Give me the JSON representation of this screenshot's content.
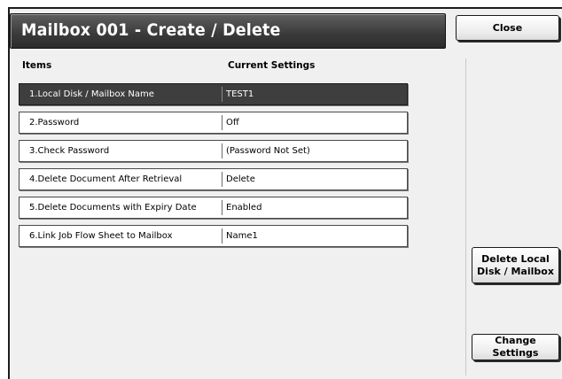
{
  "window": {
    "title": "Mailbox 001 - Create / Delete"
  },
  "buttons": {
    "close": "Close",
    "delete_local_disk": "Delete Local Disk / Mailbox",
    "change_settings": "Change Settings"
  },
  "table": {
    "headers": {
      "items": "Items",
      "current_settings": "Current Settings"
    },
    "rows": [
      {
        "item": "1.Local Disk / Mailbox Name",
        "value": "TEST1",
        "selected": true
      },
      {
        "item": "2.Password",
        "value": "Off",
        "selected": false
      },
      {
        "item": "3.Check Password",
        "value": "(Password Not Set)",
        "selected": false
      },
      {
        "item": "4.Delete Document After Retrieval",
        "value": "Delete",
        "selected": false
      },
      {
        "item": "5.Delete Documents with Expiry Date",
        "value": "Enabled",
        "selected": false
      },
      {
        "item": "6.Link Job Flow Sheet to Mailbox",
        "value": "Name1",
        "selected": false
      }
    ]
  }
}
